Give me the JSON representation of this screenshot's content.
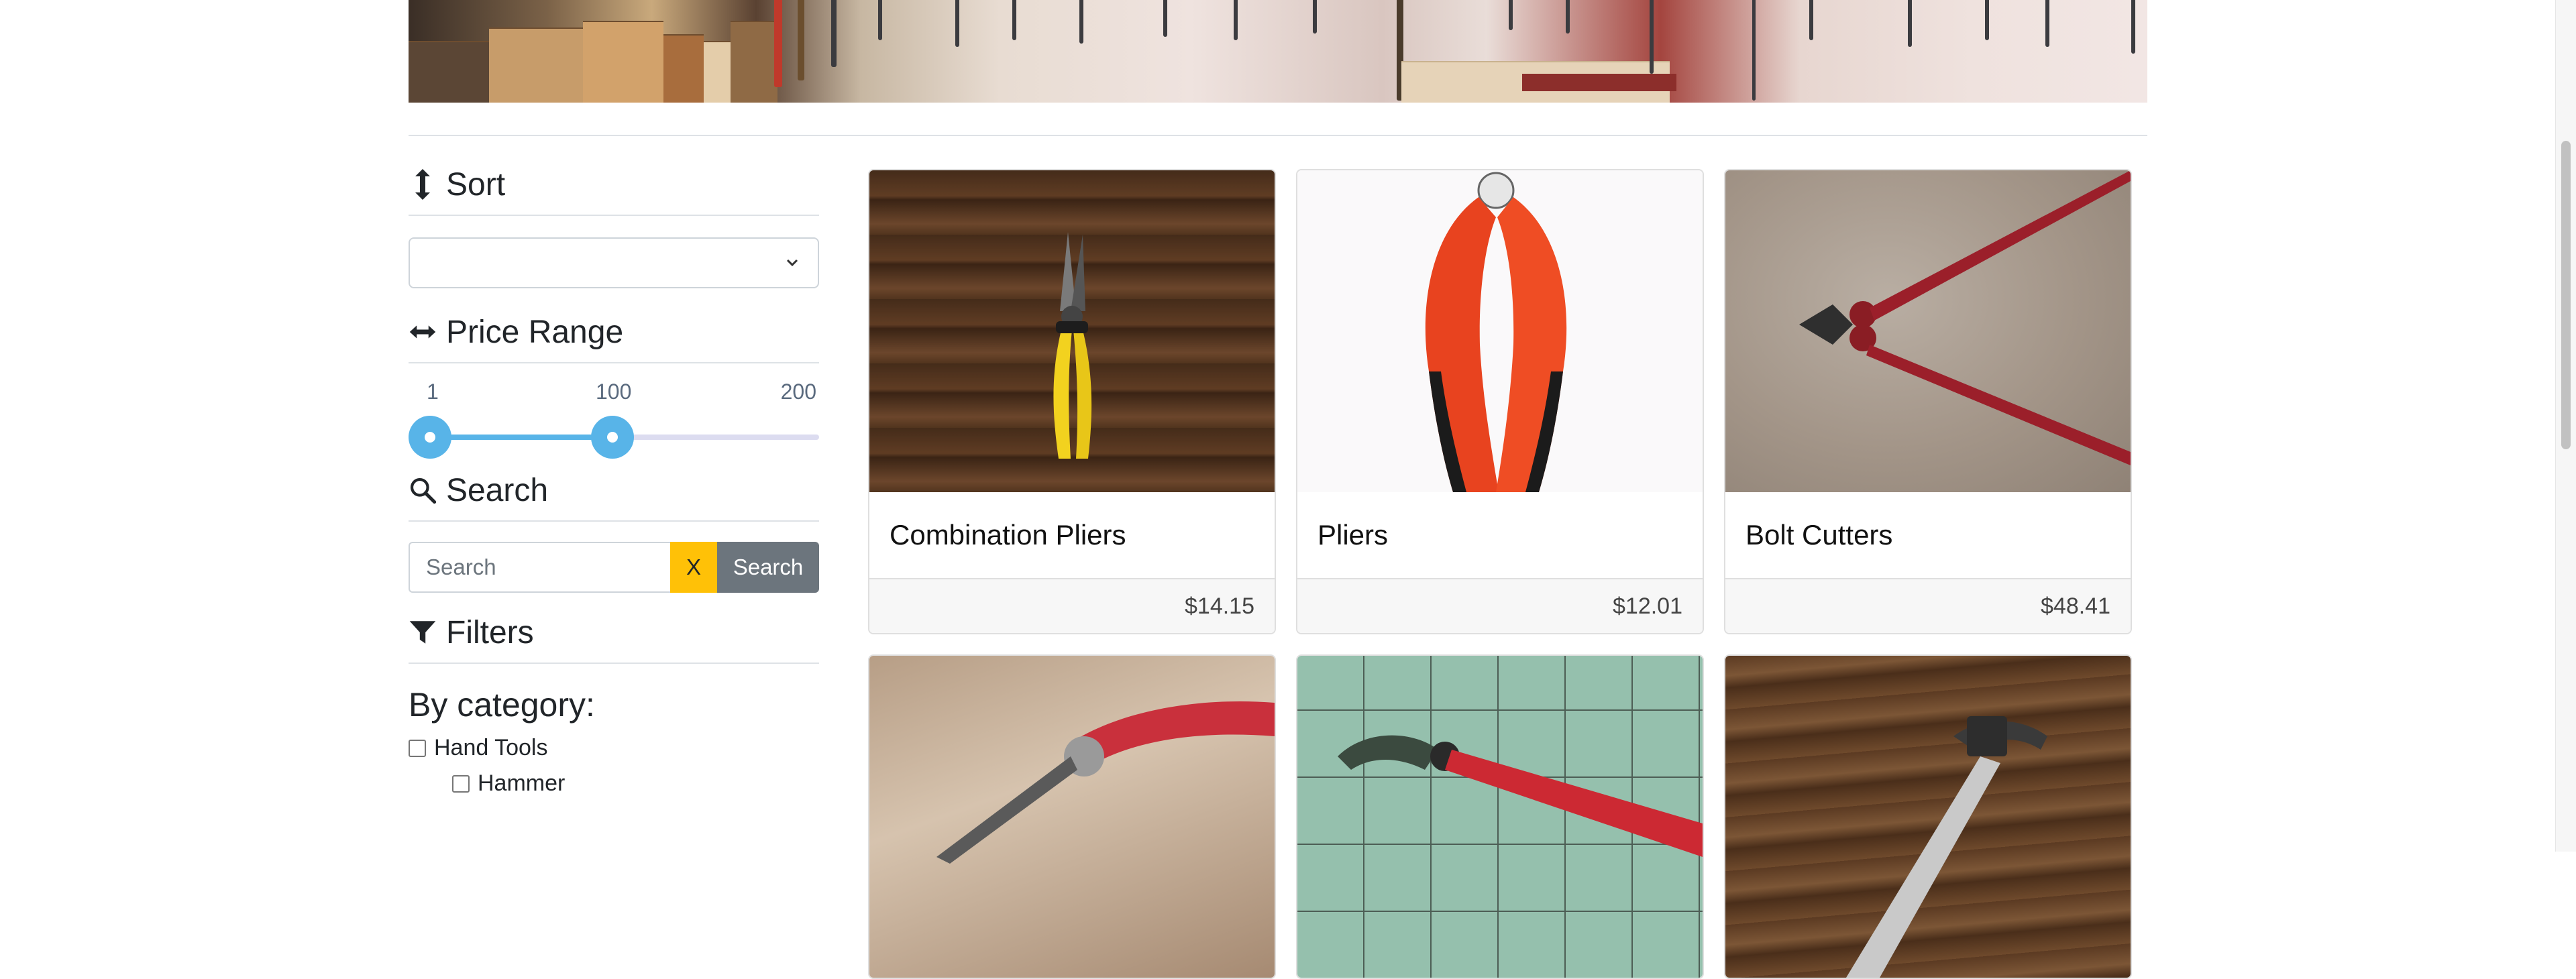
{
  "sidebar": {
    "sort": {
      "title": "Sort",
      "selected": ""
    },
    "price_range": {
      "title": "Price Range",
      "min_label": "1",
      "mid_label": "100",
      "max_label": "200",
      "low_value": 1,
      "high_value": 100
    },
    "search": {
      "title": "Search",
      "placeholder": "Search",
      "clear_label": "X",
      "button_label": "Search"
    },
    "filters": {
      "title": "Filters",
      "by_category_label": "By category:",
      "categories": [
        {
          "label": "Hand Tools",
          "checked": false
        },
        {
          "label": "Hammer",
          "checked": false
        }
      ]
    }
  },
  "products": [
    {
      "name": "Combination Pliers",
      "price": "$14.15"
    },
    {
      "name": "Pliers",
      "price": "$12.01"
    },
    {
      "name": "Bolt Cutters",
      "price": "$48.41"
    }
  ],
  "colors": {
    "accent": "#58b4e8",
    "clear_button": "#ffc107",
    "search_button": "#6c757d"
  }
}
